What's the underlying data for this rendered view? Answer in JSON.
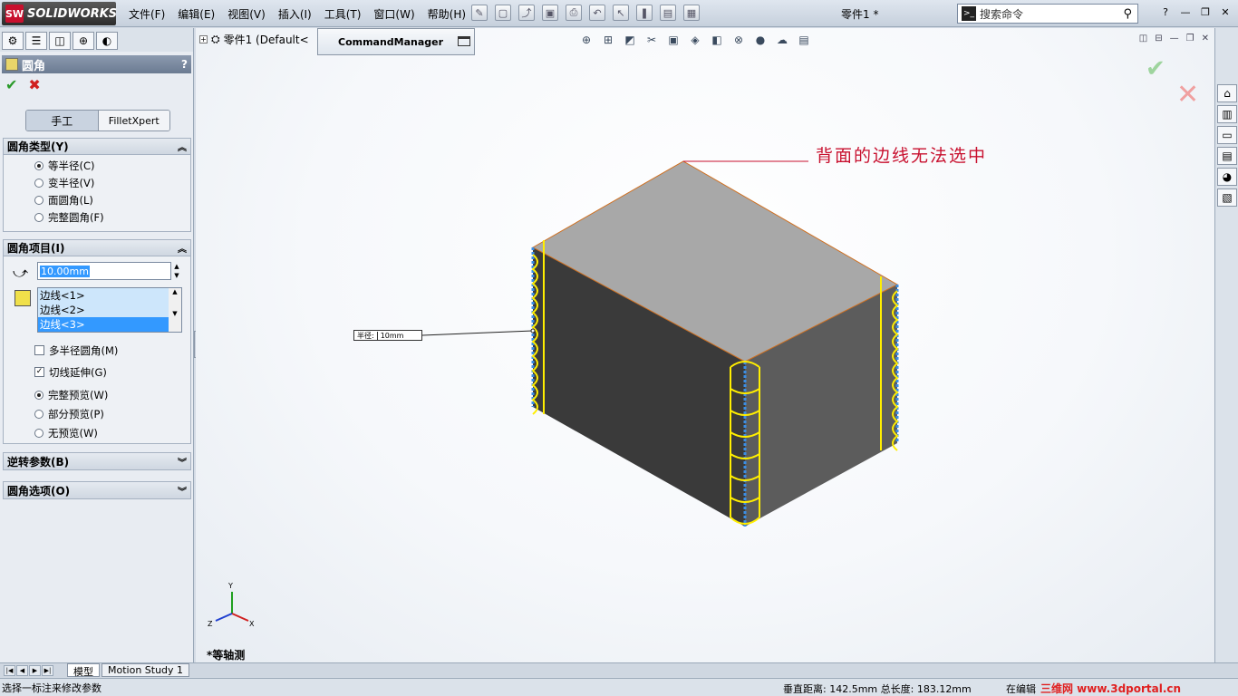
{
  "app": {
    "logo": "SOLIDWORKS",
    "logo_mark": "SW",
    "menus": [
      "文件(F)",
      "编辑(E)",
      "视图(V)",
      "插入(I)",
      "工具(T)",
      "窗口(W)",
      "帮助(H)"
    ],
    "doc_title": "零件1 *",
    "search_placeholder": "搜索命令"
  },
  "property_manager": {
    "title": "圆角",
    "help": "?",
    "mode_tabs": [
      "手工",
      "FilletXpert"
    ],
    "fillet_type": {
      "header": "圆角类型(Y)",
      "options": [
        "等半径(C)",
        "变半径(V)",
        "面圆角(L)",
        "完整圆角(F)"
      ],
      "selected_index": 0
    },
    "fillet_items": {
      "header": "圆角项目(I)",
      "radius_value": "10.00mm",
      "edges": [
        "边线<1>",
        "边线<2>",
        "边线<3>"
      ],
      "selected_edge_index": 2,
      "multi_radius": "多半径圆角(M)",
      "tangent_propagation": "切线延伸(G)",
      "preview_options": [
        "完整预览(W)",
        "部分预览(P)",
        "无预览(W)"
      ],
      "preview_selected_index": 0
    },
    "reverse_params": {
      "header": "逆转参数(B)"
    },
    "fillet_options": {
      "header": "圆角选项(O)"
    }
  },
  "viewport": {
    "tree_root": "零件1  (Default<",
    "command_manager": "CommandManager",
    "annotation": "背面的边线无法选中",
    "dimension_label": "半径:",
    "dimension_value": "10mm",
    "view_name": "*等轴测",
    "axes": [
      "Y",
      "X",
      "Z"
    ]
  },
  "bottom_tabs": [
    "模型",
    "Motion Study 1"
  ],
  "status": {
    "message": "选择一标注来修改参数",
    "measure": "垂直距离: 142.5mm 总长度: 183.12mm",
    "editing": "在编辑",
    "watermark": "三维网 www.3dportal.cn"
  },
  "colors": {
    "annotation": "#c8102e",
    "fillet_preview": "#ffee00",
    "selected_edge": "#3a8ee6",
    "top_face": "#a8a8a8",
    "left_face": "#3a3a3a",
    "right_face": "#5c5c5c"
  }
}
